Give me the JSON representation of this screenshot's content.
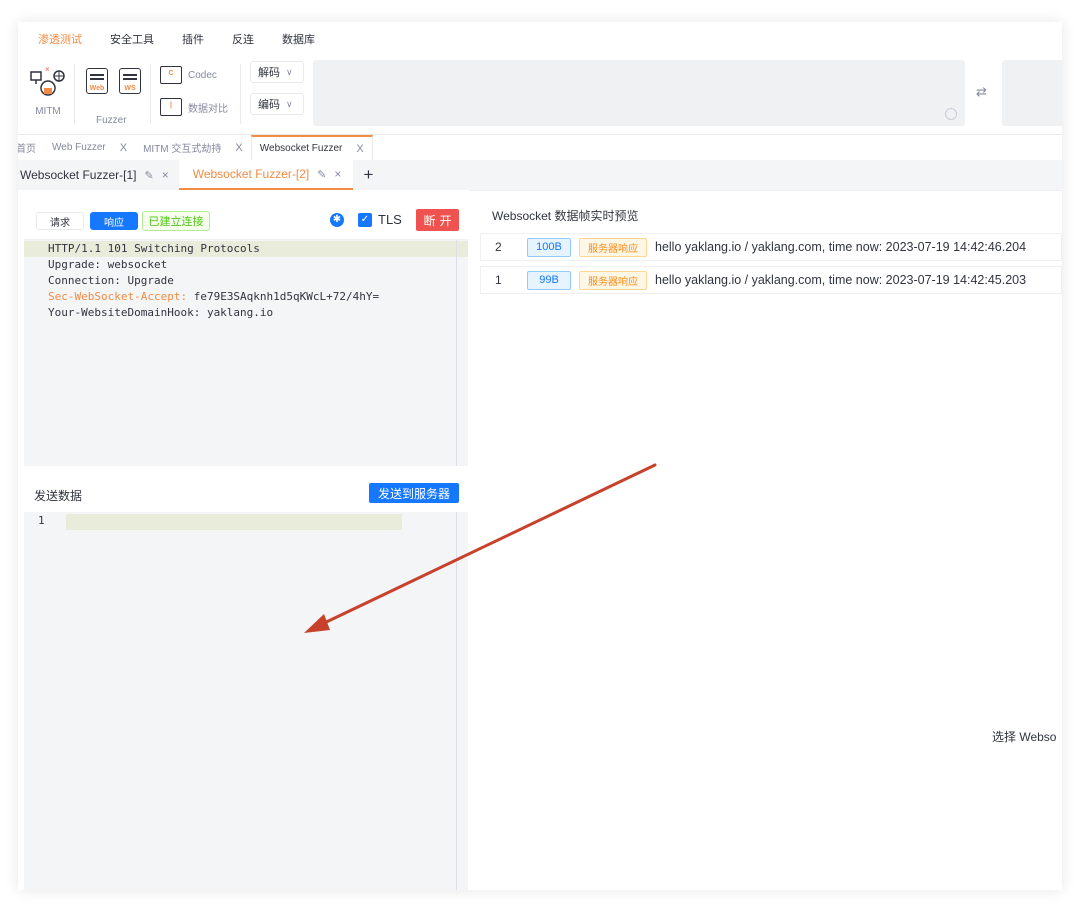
{
  "menu": {
    "items": [
      "渗透测试",
      "安全工具",
      "插件",
      "反连",
      "数据库"
    ],
    "active_index": 0
  },
  "toolbar": {
    "mitm_label": "MITM",
    "fuzzer_label": "Fuzzer",
    "web_sub": "Web",
    "ws_sub": "WS",
    "codec_label": "Codec",
    "compare_label": "数据对比",
    "decode_select": "解码",
    "encode_select": "编码",
    "swap_glyph": "⇄"
  },
  "main_tabs": {
    "home": "首页",
    "web_fuzzer": "Web Fuzzer",
    "mitm": "MITM 交互式劫持",
    "ws_fuzzer": "Websocket Fuzzer",
    "close": "X"
  },
  "sub_tabs": {
    "tab1": "Websocket Fuzzer-[1]",
    "tab2": "Websocket Fuzzer-[2]",
    "add": "+",
    "close": "×",
    "edit": "✎"
  },
  "left": {
    "request_btn": "请求",
    "response_btn": "响应",
    "connected_badge": "已建立连接",
    "tls_label": "TLS",
    "disconnect_btn": "断开",
    "response_lines": [
      {
        "key": "",
        "text": "HTTP/1.1 101 Switching Protocols"
      },
      {
        "key": "",
        "text": "Upgrade: websocket"
      },
      {
        "key": "",
        "text": "Connection: Upgrade"
      },
      {
        "key": "Sec-WebSocket-Accept:",
        "text": " fe79E3SAqknh1d5qKWcL+72/4hY="
      },
      {
        "key": "",
        "text": "Your-WebsiteDomainHook: yaklang.io"
      }
    ],
    "send_title": "发送数据",
    "send_btn": "发送到服务器",
    "editor_line_number": "1"
  },
  "right": {
    "title": "Websocket 数据帧实时预览",
    "frames": [
      {
        "index": "2",
        "size": "100B",
        "type": "服务器响应",
        "message": "hello yaklang.io / yaklang.com, time now: 2023-07-19 14:42:46.204"
      },
      {
        "index": "1",
        "size": "99B",
        "type": "服务器响应",
        "message": "hello yaklang.io / yaklang.com, time now: 2023-07-19 14:42:45.203"
      }
    ],
    "hint": "选择 Webso"
  },
  "colors": {
    "accent": "#f28b44",
    "primary": "#1677ff",
    "danger": "#f0524f",
    "success": "#52c41a",
    "annotation_arrow": "#c8412b"
  }
}
